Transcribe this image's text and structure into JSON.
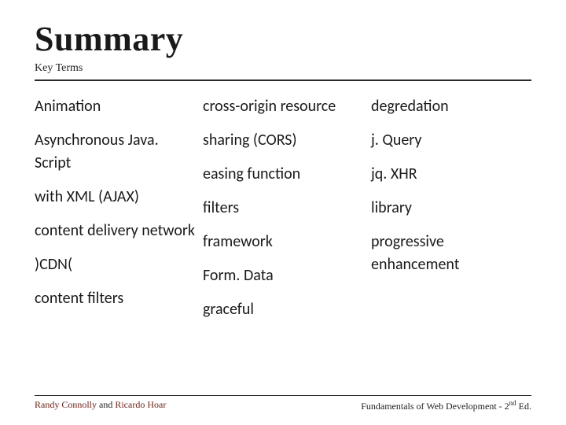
{
  "header": {
    "title": "Summary",
    "subtitle": "Key Terms"
  },
  "columns": {
    "col1": [
      " Animation",
      "Asynchronous Java. Script",
      "with XML (AJAX)",
      "content delivery network",
      ")CDN(",
      "content filters"
    ],
    "col2": [
      "cross-origin resource",
      "sharing (CORS)",
      "easing function",
      "filters",
      "framework",
      "Form. Data",
      "graceful"
    ],
    "col3": [
      "degredation",
      "j. Query",
      "jq. XHR",
      "library",
      "progressive enhancement"
    ]
  },
  "footer": {
    "left_author1": "Randy Connolly",
    "left_and": " and ",
    "left_author2": "Ricardo Hoar",
    "right_pre": "Fundamentals of Web Development - 2",
    "right_sup": "nd",
    "right_post": " Ed."
  }
}
